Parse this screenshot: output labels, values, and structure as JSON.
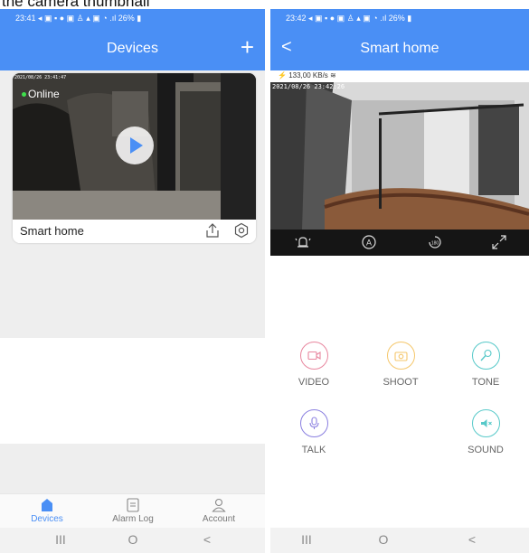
{
  "caption": "the camera thumbnail",
  "left": {
    "status_bar": "23:41 ◂ ▣ ▪ ● ▣ ♙ ▴    ▣ ◔ .ıl 26% ▮",
    "title": "Devices",
    "add_label": "+",
    "device": {
      "timestamp": "2021/08/26 23:41:47",
      "status": "Online",
      "name": "Smart home"
    },
    "tabs": [
      {
        "label": "Devices",
        "icon": "devices-icon"
      },
      {
        "label": "Alarm Log",
        "icon": "alarm-log-icon"
      },
      {
        "label": "Account",
        "icon": "account-icon"
      }
    ],
    "nav": {
      "recents": "III",
      "home": "O",
      "back": "<"
    }
  },
  "right": {
    "status_bar": "23:42 ◂ ▣ ▪ ● ▣ ♙ ▴    ▣ ◔ .ıl 26% ▮",
    "title": "Smart home",
    "back_label": "<",
    "speed": "133,00 KB/s",
    "timestamp": "2021/08/26 23:42:26",
    "controls": [
      "alarm-icon",
      "auto-icon",
      "rotate-180-icon",
      "fullscreen-icon"
    ],
    "actions": [
      {
        "label": "VIDEO",
        "color": "#e8879f"
      },
      {
        "label": "SHOOT",
        "color": "#f5c76b"
      },
      {
        "label": "TONE",
        "color": "#57c9c9"
      },
      {
        "label": "TALK",
        "color": "#8a7fe0"
      },
      {
        "label": "SOUND",
        "color": "#57c9c9"
      }
    ],
    "nav": {
      "recents": "III",
      "home": "O",
      "back": "<"
    }
  },
  "colors": {
    "brand": "#4a8ff5",
    "online": "#3fe04c"
  }
}
